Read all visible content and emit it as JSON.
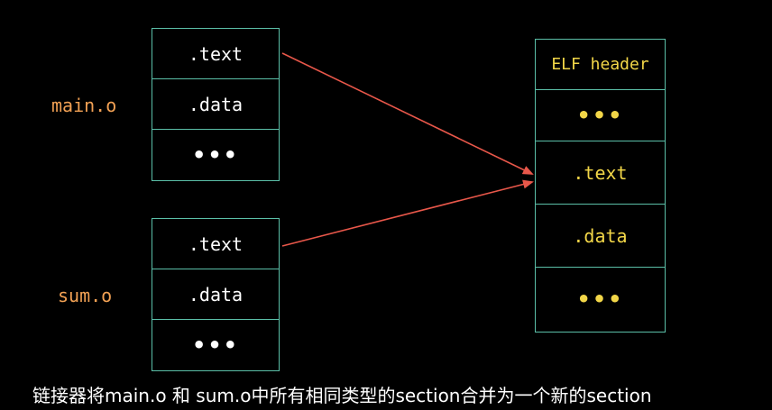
{
  "colors": {
    "background": "#000000",
    "box_border": "#5bbfa8",
    "file_label": "#f2a154",
    "input_text": "#ffffff",
    "output_text": "#f2d648",
    "arrow": "#e8574a",
    "caption_text": "#ffffff"
  },
  "files": {
    "main": {
      "label": "main.o",
      "sections": [
        ".text",
        ".data",
        "•••"
      ]
    },
    "sum": {
      "label": "sum.o",
      "sections": [
        ".text",
        ".data",
        "•••"
      ]
    }
  },
  "executable": {
    "sections": [
      "ELF header",
      "•••",
      ".text",
      ".data",
      "•••"
    ]
  },
  "arrows": [
    {
      "from": "main.o .text",
      "to": ".text"
    },
    {
      "from": "sum.o .text",
      "to": ".text"
    }
  ],
  "caption": "链接器将main.o 和 sum.o中所有相同类型的section合并为一个新的section"
}
